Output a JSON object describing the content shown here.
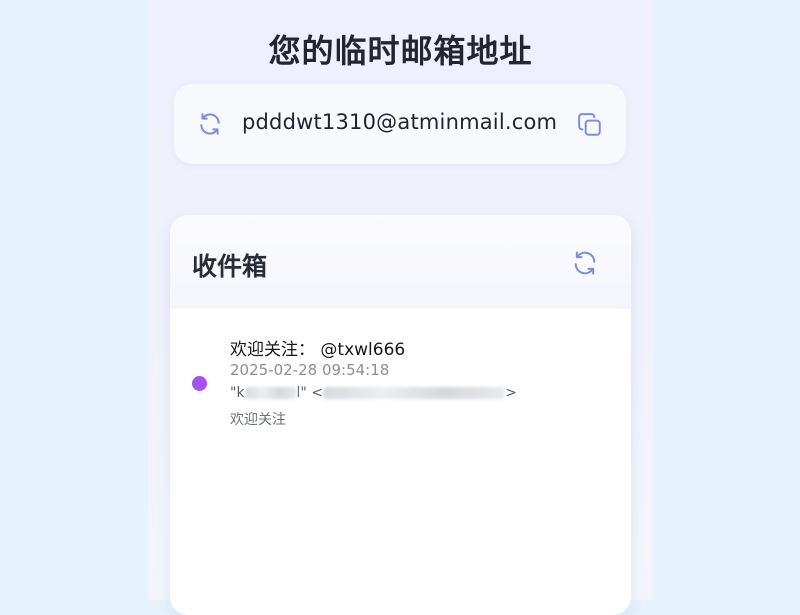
{
  "header": {
    "title": "您的临时邮箱地址"
  },
  "email_card": {
    "address": "pdddwt1310@atminmail.com",
    "refresh_icon": "refresh-icon",
    "copy_icon": "copy-icon"
  },
  "inbox": {
    "title": "收件箱",
    "refresh_icon": "refresh-icon",
    "messages": [
      {
        "subject": "欢迎关注： @txwl666",
        "date": "2025-02-28 09:54:18",
        "from_prefix": "\"k",
        "from_mid": "l\" <",
        "from_suffix": ">",
        "preview": "欢迎关注",
        "unread": true
      }
    ]
  },
  "colors": {
    "accent": "#7d8fd6",
    "unread_dot": "#a653ea",
    "page_bg": "#e6f2fd"
  }
}
